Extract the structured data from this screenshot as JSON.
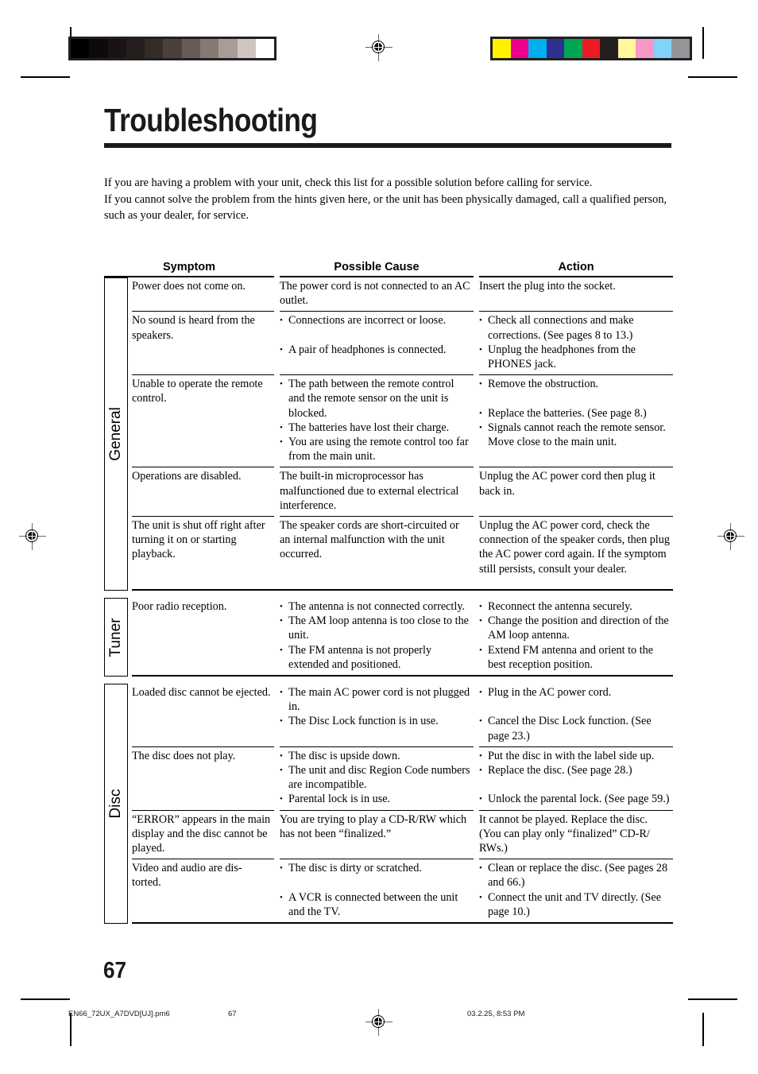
{
  "document": {
    "title": "Troubleshooting",
    "intro_lines": [
      "If you are having a problem with your unit, check this list for a possible solution before calling for service.",
      "If you cannot solve the problem from the hints given here, or the unit has been physically damaged, call a qualified person,",
      "such as your dealer, for service."
    ],
    "page_number": "67"
  },
  "table": {
    "headers": {
      "symptom": "Symptom",
      "cause": "Possible Cause",
      "action": "Action"
    },
    "groups": [
      {
        "label": "General",
        "rows": [
          {
            "symptom": "Power does not come on.",
            "cause_plain": "The power cord is not connected to an AC outlet.",
            "action_plain": "Insert the plug into the socket."
          },
          {
            "symptom": "No sound is heard from the speakers.",
            "cause_bullets": [
              "Connections are incorrect or loose.",
              "A pair of headphones is connected."
            ],
            "action_bullets": [
              "Check all connections and make corrections. (See pages 8 to 13.)",
              "Unplug the headphones from the PHONES jack."
            ]
          },
          {
            "symptom": "Unable to operate the remote control.",
            "cause_bullets": [
              "The path between the remote control and the remote sensor on the unit is blocked.",
              "The batteries have lost their charge.",
              "You are using the remote control too far from the main unit."
            ],
            "action_bullets": [
              "Remove the obstruction.",
              "Replace the batteries. (See page 8.)",
              "Signals cannot reach the remote sensor. Move close to the main unit."
            ]
          },
          {
            "symptom": "Operations are disabled.",
            "cause_plain": "The built-in microprocessor has malfunctioned due to external electrical interference.",
            "action_plain": "Unplug the AC power cord then plug it back in."
          },
          {
            "symptom": "The unit is shut off right after turning it on or starting playback.",
            "cause_plain": "The speaker cords are short-circuited or an internal malfunction with the unit occurred.",
            "action_plain": "Unplug the AC power cord, check the connection of the speaker cords, then plug the AC power cord again. If the symptom still persists, consult your dealer."
          }
        ]
      },
      {
        "label": "Tuner",
        "rows": [
          {
            "symptom": "Poor radio reception.",
            "cause_bullets": [
              "The antenna is not connected correctly.",
              "The AM loop antenna is too close to the unit.",
              "The FM antenna is not properly extended and positioned."
            ],
            "action_bullets": [
              "Reconnect the antenna securely.",
              "Change the position and direction of the AM loop antenna.",
              "Extend FM antenna and orient to the best reception position."
            ]
          }
        ]
      },
      {
        "label": "Disc",
        "rows": [
          {
            "symptom": "Loaded disc cannot be ejected.",
            "cause_bullets": [
              "The main AC power cord is not plugged in.",
              "The Disc Lock function is in use."
            ],
            "action_bullets": [
              "Plug in the AC power cord.",
              "Cancel the Disc Lock function. (See page 23.)"
            ]
          },
          {
            "symptom": "The disc does not play.",
            "cause_bullets": [
              "The disc is upside down.",
              "The unit and disc Region Code numbers are incompatible.",
              "Parental lock is in use."
            ],
            "action_bullets": [
              "Put the disc in with the label side up.",
              "Replace the disc. (See page 28.)",
              "Unlock the parental lock. (See page 59.)"
            ]
          },
          {
            "symptom": "“ERROR” appears in the main display and the disc cannot be played.",
            "cause_plain": "You are trying to play a CD-R/RW which has not been “finalized.”",
            "action_plain": "It cannot be played. Replace the disc. (You can play only “finalized” CD-R/ RWs.)"
          },
          {
            "symptom": "Video and audio are dis-torted.",
            "cause_bullets": [
              "The disc is dirty or scratched.",
              "A VCR is connected between the unit and the TV."
            ],
            "action_bullets": [
              "Clean or replace the disc. (See pages 28 and 66.)",
              "Connect the unit and TV directly. (See page 10.)"
            ]
          }
        ]
      }
    ]
  },
  "print_footer": {
    "filename": "EN66_72UX_A7DVD[UJ].pm6",
    "page": "67",
    "timestamp": "03.2.25, 8:53 PM"
  },
  "print_marks": {
    "grayscale_swatches": [
      "#000000",
      "#0d0a0a",
      "#191413",
      "#241e1c",
      "#342c29",
      "#4a413d",
      "#675c57",
      "#877a74",
      "#a89c96",
      "#cfc6c1",
      "#ffffff"
    ],
    "color_swatches": [
      "#fff200",
      "#ec008c",
      "#00aeef",
      "#2e3192",
      "#00a651",
      "#ed1c24",
      "#231f20",
      "#fff79a",
      "#f797c8",
      "#7fd4f7",
      "#939598"
    ]
  }
}
